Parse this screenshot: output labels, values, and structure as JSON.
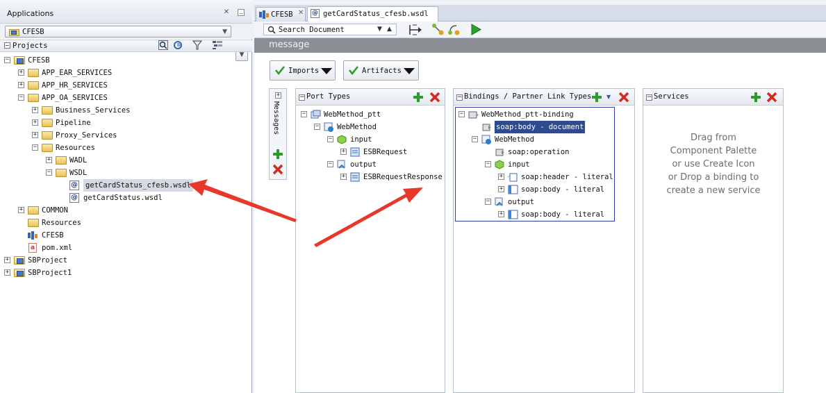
{
  "left_panel": {
    "title": "Applications",
    "app_selector": "CFESB",
    "projects_label": "Projects",
    "tree": [
      {
        "label": "CFESB",
        "level": 0,
        "kind": "project",
        "expanded": true
      },
      {
        "label": "APP_EAR_SERVICES",
        "level": 1,
        "kind": "folder",
        "expanded": false
      },
      {
        "label": "APP_HR_SERVICES",
        "level": 1,
        "kind": "folder",
        "expanded": false
      },
      {
        "label": "APP_OA_SERVICES",
        "level": 1,
        "kind": "folder",
        "expanded": true
      },
      {
        "label": "Business_Services",
        "level": 2,
        "kind": "folder",
        "expanded": false
      },
      {
        "label": "Pipeline",
        "level": 2,
        "kind": "folder",
        "expanded": false
      },
      {
        "label": "Proxy_Services",
        "level": 2,
        "kind": "folder",
        "expanded": false
      },
      {
        "label": "Resources",
        "level": 2,
        "kind": "folder",
        "expanded": true
      },
      {
        "label": "WADL",
        "level": 3,
        "kind": "folder",
        "expanded": false
      },
      {
        "label": "WSDL",
        "level": 3,
        "kind": "folder",
        "expanded": true
      },
      {
        "label": "getCardStatus_cfesb.wsdl",
        "level": 4,
        "kind": "wsdl",
        "selected": true
      },
      {
        "label": "getCardStatus.wsdl",
        "level": 4,
        "kind": "wsdl"
      },
      {
        "label": "COMMON",
        "level": 1,
        "kind": "folder",
        "expanded": false
      },
      {
        "label": "Resources",
        "level": 1,
        "kind": "folder-leaf"
      },
      {
        "label": "CFESB",
        "level": 1,
        "kind": "sb"
      },
      {
        "label": "pom.xml",
        "level": 1,
        "kind": "xml"
      },
      {
        "label": "SBProject",
        "level": 0,
        "kind": "project",
        "expanded": false
      },
      {
        "label": "SBProject1",
        "level": 0,
        "kind": "project",
        "expanded": false
      }
    ]
  },
  "tabs": [
    {
      "label": "CFESB",
      "active": false
    },
    {
      "label": "getCardStatus_cfesb.wsdl",
      "active": true
    }
  ],
  "toolbar": {
    "search_placeholder": "Search Document"
  },
  "editor_title": "message",
  "imports_label": "Imports",
  "artifacts_label": "Artifacts",
  "messages_label": "Messages",
  "port_types": {
    "title": "Port Types",
    "items": [
      {
        "label": "WebMethod_ptt",
        "level": 0
      },
      {
        "label": "WebMethod",
        "level": 1
      },
      {
        "label": "input",
        "level": 2
      },
      {
        "label": "ESBRequest",
        "level": 3
      },
      {
        "label": "output",
        "level": 2
      },
      {
        "label": "ESBRequestResponse",
        "level": 3
      }
    ]
  },
  "bindings": {
    "title": "Bindings / Partner Link Types",
    "items": [
      {
        "label": "WebMethod_ptt-binding",
        "level": 0
      },
      {
        "label": "soap:body - document",
        "level": 1,
        "selected": true
      },
      {
        "label": "WebMethod",
        "level": 1
      },
      {
        "label": "soap:operation",
        "level": 2
      },
      {
        "label": "input",
        "level": 2
      },
      {
        "label": "soap:header - literal",
        "level": 3
      },
      {
        "label": "soap:body - literal",
        "level": 3
      },
      {
        "label": "output",
        "level": 2
      },
      {
        "label": "soap:body - literal",
        "level": 3
      }
    ]
  },
  "services": {
    "title": "Services",
    "empty_lines": [
      "Drag from",
      "Component Palette",
      "or use Create Icon",
      "or Drop a binding to",
      "create a new service"
    ]
  },
  "colors": {
    "arrow": "#e8382c",
    "add_green": "#2c9d2c",
    "delete_red": "#d52b1e",
    "selection_border": "#2d3fa5"
  }
}
